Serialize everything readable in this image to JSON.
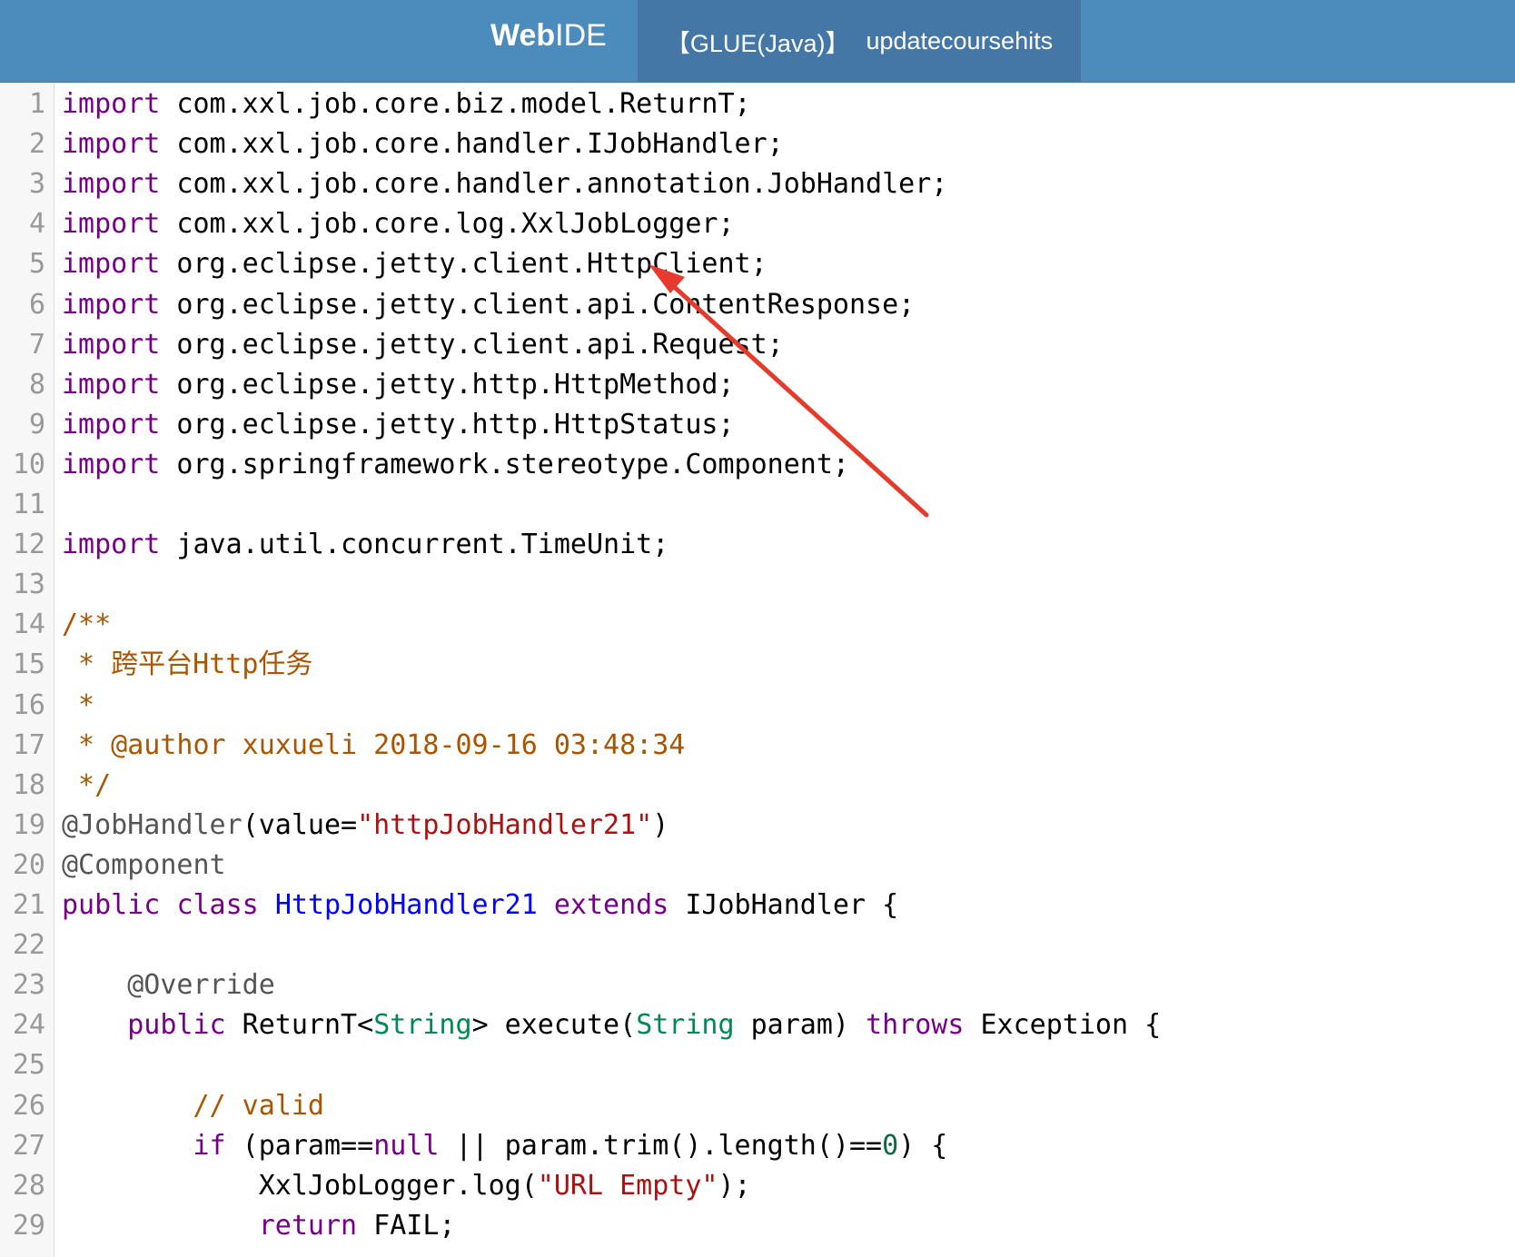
{
  "header": {
    "brand_bold": "Web",
    "brand_rest": "IDE",
    "file_type": "【GLUE(Java)】",
    "file_name": "updatecoursehits"
  },
  "colors": {
    "header_bg": "#4c8cbd",
    "tab_bg": "#4477a6",
    "arrow": "#e53a2c"
  },
  "annotation": {
    "arrow_target": "HttpClient"
  },
  "code": [
    {
      "n": "1",
      "tokens": [
        {
          "t": "import",
          "c": "kw"
        },
        {
          "t": " com.xxl.job.core.biz.model.ReturnT;"
        }
      ]
    },
    {
      "n": "2",
      "tokens": [
        {
          "t": "import",
          "c": "kw"
        },
        {
          "t": " com.xxl.job.core.handler.IJobHandler;"
        }
      ]
    },
    {
      "n": "3",
      "tokens": [
        {
          "t": "import",
          "c": "kw"
        },
        {
          "t": " com.xxl.job.core.handler.annotation.JobHandler;"
        }
      ]
    },
    {
      "n": "4",
      "tokens": [
        {
          "t": "import",
          "c": "kw"
        },
        {
          "t": " com.xxl.job.core.log.XxlJobLogger;"
        }
      ]
    },
    {
      "n": "5",
      "tokens": [
        {
          "t": "import",
          "c": "kw"
        },
        {
          "t": " org.eclipse.jetty.client.HttpClient;"
        }
      ]
    },
    {
      "n": "6",
      "tokens": [
        {
          "t": "import",
          "c": "kw"
        },
        {
          "t": " org.eclipse.jetty.client.api.ContentResponse;"
        }
      ]
    },
    {
      "n": "7",
      "tokens": [
        {
          "t": "import",
          "c": "kw"
        },
        {
          "t": " org.eclipse.jetty.client.api.Request;"
        }
      ]
    },
    {
      "n": "8",
      "tokens": [
        {
          "t": "import",
          "c": "kw"
        },
        {
          "t": " org.eclipse.jetty.http.HttpMethod;"
        }
      ]
    },
    {
      "n": "9",
      "tokens": [
        {
          "t": "import",
          "c": "kw"
        },
        {
          "t": " org.eclipse.jetty.http.HttpStatus;"
        }
      ]
    },
    {
      "n": "10",
      "tokens": [
        {
          "t": "import",
          "c": "kw"
        },
        {
          "t": " org.springframework.stereotype.Component;"
        }
      ]
    },
    {
      "n": "11",
      "tokens": []
    },
    {
      "n": "12",
      "tokens": [
        {
          "t": "import",
          "c": "kw"
        },
        {
          "t": " java.util.concurrent.TimeUnit;"
        }
      ]
    },
    {
      "n": "13",
      "tokens": []
    },
    {
      "n": "14",
      "tokens": [
        {
          "t": "/**",
          "c": "cm"
        }
      ]
    },
    {
      "n": "15",
      "tokens": [
        {
          "t": " * 跨平台Http任务",
          "c": "cm"
        }
      ]
    },
    {
      "n": "16",
      "tokens": [
        {
          "t": " *",
          "c": "cm"
        }
      ]
    },
    {
      "n": "17",
      "tokens": [
        {
          "t": " * @author xuxueli 2018-09-16 03:48:34",
          "c": "cm"
        }
      ]
    },
    {
      "n": "18",
      "tokens": [
        {
          "t": " */",
          "c": "cm"
        }
      ]
    },
    {
      "n": "19",
      "tokens": [
        {
          "t": "@JobHandler",
          "c": "meta"
        },
        {
          "t": "(value="
        },
        {
          "t": "\"httpJobHandler21\"",
          "c": "st"
        },
        {
          "t": ")"
        }
      ]
    },
    {
      "n": "20",
      "tokens": [
        {
          "t": "@Component",
          "c": "meta"
        }
      ]
    },
    {
      "n": "21",
      "tokens": [
        {
          "t": "public",
          "c": "kw"
        },
        {
          "t": " "
        },
        {
          "t": "class",
          "c": "kw"
        },
        {
          "t": " "
        },
        {
          "t": "HttpJobHandler21",
          "c": "ty"
        },
        {
          "t": " "
        },
        {
          "t": "extends",
          "c": "kw"
        },
        {
          "t": " IJobHandler {"
        }
      ]
    },
    {
      "n": "22",
      "tokens": []
    },
    {
      "n": "23",
      "tokens": [
        {
          "t": "    "
        },
        {
          "t": "@Override",
          "c": "meta"
        }
      ]
    },
    {
      "n": "24",
      "tokens": [
        {
          "t": "    "
        },
        {
          "t": "public",
          "c": "kw"
        },
        {
          "t": " ReturnT<"
        },
        {
          "t": "String",
          "c": "vt"
        },
        {
          "t": "> execute("
        },
        {
          "t": "String",
          "c": "vt"
        },
        {
          "t": " param) "
        },
        {
          "t": "throws",
          "c": "kw"
        },
        {
          "t": " Exception {"
        }
      ]
    },
    {
      "n": "25",
      "tokens": []
    },
    {
      "n": "26",
      "tokens": [
        {
          "t": "        "
        },
        {
          "t": "// valid",
          "c": "cm"
        }
      ]
    },
    {
      "n": "27",
      "tokens": [
        {
          "t": "        "
        },
        {
          "t": "if",
          "c": "kw"
        },
        {
          "t": " (param=="
        },
        {
          "t": "null",
          "c": "kw"
        },
        {
          "t": " || param.trim().length()=="
        },
        {
          "t": "0",
          "c": "nm"
        },
        {
          "t": ") {"
        }
      ]
    },
    {
      "n": "28",
      "tokens": [
        {
          "t": "            XxlJobLogger.log("
        },
        {
          "t": "\"URL Empty\"",
          "c": "st"
        },
        {
          "t": ");"
        }
      ]
    },
    {
      "n": "29",
      "tokens": [
        {
          "t": "            "
        },
        {
          "t": "return",
          "c": "kw"
        },
        {
          "t": " FAIL;"
        }
      ]
    }
  ]
}
